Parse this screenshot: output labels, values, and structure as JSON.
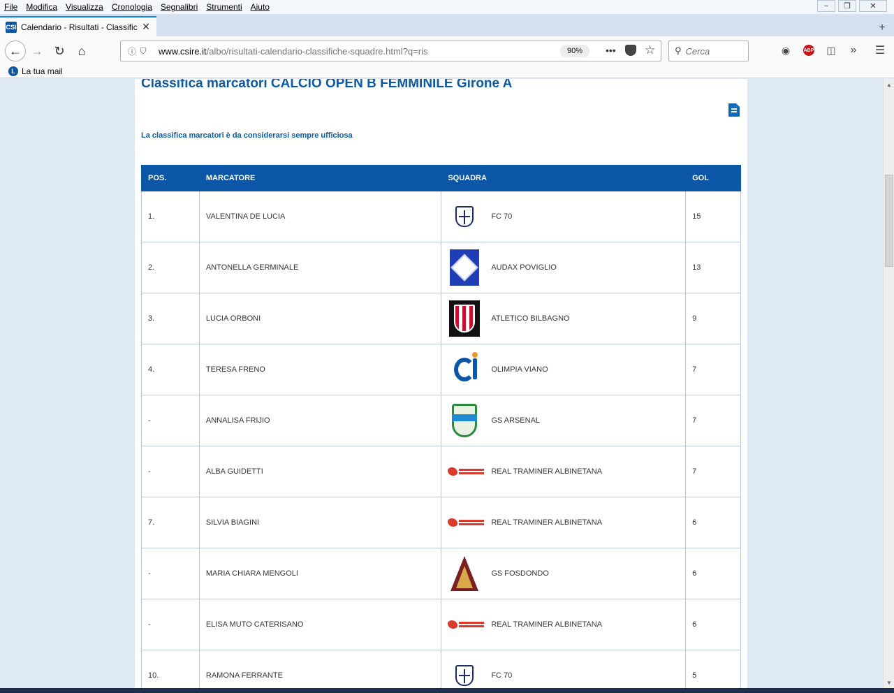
{
  "menubar": [
    "File",
    "Modifica",
    "Visualizza",
    "Cronologia",
    "Segnalibri",
    "Strumenti",
    "Aiuto"
  ],
  "window_controls": {
    "minimize": "−",
    "restore": "❐",
    "close": "✕"
  },
  "tab": {
    "favicon": "CSI",
    "title": "Calendario - Risultati - Classific",
    "close": "✕"
  },
  "navbar": {
    "back": "←",
    "forward": "→",
    "reload": "↻",
    "home": "⌂",
    "url_host": "www.csire.it",
    "url_path": "/albo/risultati-calendario-classifiche-squadre.html?q=ris",
    "zoom": "90%",
    "more": "•••",
    "search_placeholder": "Cerca"
  },
  "bookmarks": {
    "item": "La tua mail"
  },
  "page": {
    "title": "Classifica marcatori CALCIO OPEN B FEMMINILE Girone A",
    "notice": "La classifica marcatori è da considerarsi sempre ufficiosa",
    "headers": {
      "pos": "POS.",
      "name": "MARCATORE",
      "team": "SQUADRA",
      "gol": "GOL"
    },
    "rows": [
      {
        "pos": "1.",
        "name": "VALENTINA DE LUCIA",
        "team": "FC 70",
        "gol": "15",
        "logo": "fc70"
      },
      {
        "pos": "2.",
        "name": "ANTONELLA GERMINALE",
        "team": "AUDAX POVIGLIO",
        "gol": "13",
        "logo": "audax"
      },
      {
        "pos": "3.",
        "name": "LUCIA ORBONI",
        "team": "ATLETICO BILBAGNO",
        "gol": "9",
        "logo": "atletico"
      },
      {
        "pos": "4.",
        "name": "TERESA FRENO",
        "team": "OLIMPIA VIANO",
        "gol": "7",
        "logo": "csi"
      },
      {
        "pos": "-",
        "name": "ANNALISA FRIJIO",
        "team": "GS ARSENAL",
        "gol": "7",
        "logo": "arsenal"
      },
      {
        "pos": "-",
        "name": "ALBA GUIDETTI",
        "team": "REAL TRAMINER ALBINETANA",
        "gol": "7",
        "logo": "real"
      },
      {
        "pos": "7.",
        "name": "SILVIA BIAGINI",
        "team": "REAL TRAMINER ALBINETANA",
        "gol": "6",
        "logo": "real"
      },
      {
        "pos": "-",
        "name": "MARIA CHIARA MENGOLI",
        "team": "GS FOSDONDO",
        "gol": "6",
        "logo": "fosdondo"
      },
      {
        "pos": "-",
        "name": "ELISA MUTO CATERISANO",
        "team": "REAL TRAMINER ALBINETANA",
        "gol": "6",
        "logo": "real"
      },
      {
        "pos": "10.",
        "name": "RAMONA FERRANTE",
        "team": "FC 70",
        "gol": "5",
        "logo": "fc70"
      }
    ]
  },
  "colors": {
    "accent": "#0b56a6",
    "title": "#0b5aa8",
    "background": "#dfe9f5"
  }
}
